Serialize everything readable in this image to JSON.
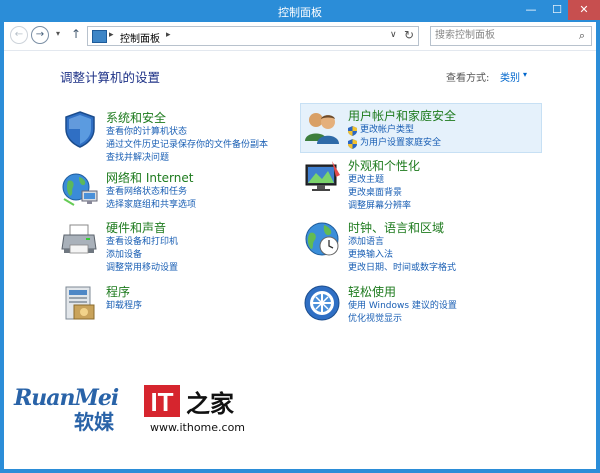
{
  "window": {
    "title": "控制面板",
    "min_glyph": "—",
    "max_glyph": "☐",
    "close_glyph": "✕"
  },
  "nav": {
    "back_glyph": "←",
    "forward_glyph": "→",
    "recent_glyph": "▾",
    "up_glyph": "↑",
    "address_crumb": "控制面板",
    "address_sep1": "▸",
    "address_sep2": "▸",
    "address_dropdown": "∨",
    "refresh_glyph": "↻",
    "search_placeholder": "搜索控制面板",
    "search_icon": "⌕"
  },
  "page": {
    "title": "调整计算机的设置",
    "view_by_label": "查看方式:",
    "view_by_value": "类别",
    "view_by_arrow": "▾"
  },
  "categories": [
    {
      "id": "system-security",
      "icon": "shield-icon",
      "title": "系统和安全",
      "links": [
        "查看你的计算机状态",
        "通过文件历史记录保存你的文件备份副本",
        "查找并解决问题"
      ]
    },
    {
      "id": "network-internet",
      "icon": "globe-network-icon",
      "title": "网络和 Internet",
      "links": [
        "查看网络状态和任务",
        "选择家庭组和共享选项"
      ]
    },
    {
      "id": "hardware-sound",
      "icon": "printer-icon",
      "title": "硬件和声音",
      "links": [
        "查看设备和打印机",
        "添加设备",
        "调整常用移动设置"
      ]
    },
    {
      "id": "programs",
      "icon": "programs-icon",
      "title": "程序",
      "links": [
        "卸载程序"
      ]
    },
    {
      "id": "user-accounts",
      "icon": "users-icon",
      "title": "用户帐户和家庭安全",
      "links": [
        "更改帐户类型",
        "为用户设置家庭安全"
      ],
      "shield_links": true
    },
    {
      "id": "appearance",
      "icon": "display-icon",
      "title": "外观和个性化",
      "links": [
        "更改主题",
        "更改桌面背景",
        "调整屏幕分辨率"
      ]
    },
    {
      "id": "clock-region",
      "icon": "clock-globe-icon",
      "title": "时钟、语言和区域",
      "links": [
        "添加语言",
        "更换输入法",
        "更改日期、时间或数字格式"
      ]
    },
    {
      "id": "ease-of-access",
      "icon": "ease-of-access-icon",
      "title": "轻松使用",
      "links": [
        "使用 Windows 建议的设置",
        "优化视觉显示"
      ]
    }
  ],
  "watermarks": {
    "ruanmei_latin": "RuanMei",
    "ruanmei_cn": "软媒",
    "it_logo_text": "IT",
    "it_logo_cn": "之家",
    "ithome_url": "www.ithome.com"
  },
  "colors": {
    "titlebar": "#2b8dd8",
    "category_title": "#1e7b1e",
    "link": "#1a5fb4",
    "heading": "#1e3287",
    "highlight": "#e5f1fb",
    "it_red": "#d6252e"
  }
}
